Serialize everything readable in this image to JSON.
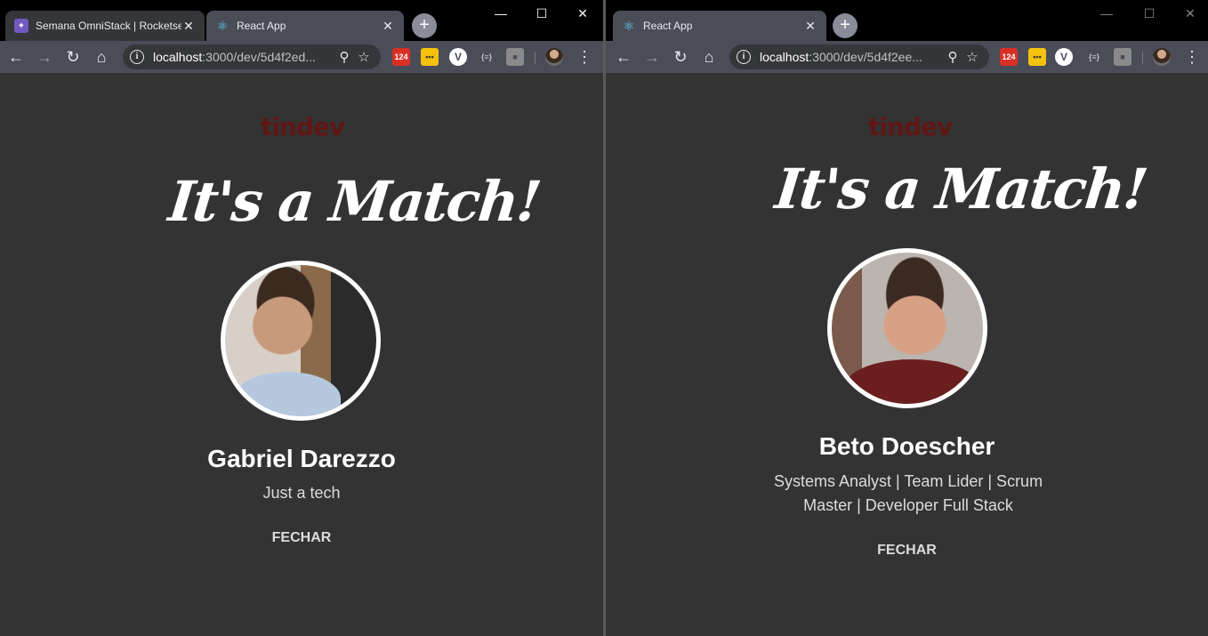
{
  "left": {
    "tabs": [
      {
        "title": "Semana OmniStack | Rocketseat",
        "favicon": "rocketseat-icon"
      },
      {
        "title": "React App",
        "favicon": "react-icon"
      }
    ],
    "omnibox": {
      "host": "localhost",
      "path": ":3000/dev/5d4f2ed..."
    },
    "ext_calendar_badge": "124",
    "page": {
      "logo": "tindev",
      "match_title": "It's a Match!",
      "name": "Gabriel Darezzo",
      "bio": "Just a tech",
      "close": "FECHAR"
    }
  },
  "right": {
    "tabs": [
      {
        "title": "React App",
        "favicon": "react-icon"
      }
    ],
    "omnibox": {
      "host": "localhost",
      "path": ":3000/dev/5d4f2ee..."
    },
    "ext_calendar_badge": "124",
    "page": {
      "logo": "tindev",
      "match_title": "It's a Match!",
      "name": "Beto Doescher",
      "bio": "Systems Analyst | Team Lider | Scrum Master | Developer Full Stack",
      "close": "FECHAR"
    }
  },
  "colors": {
    "page_bg": "#333333",
    "logo": "#601615",
    "toolbar": "#4a4c58",
    "accent_text": "#ffffff"
  }
}
